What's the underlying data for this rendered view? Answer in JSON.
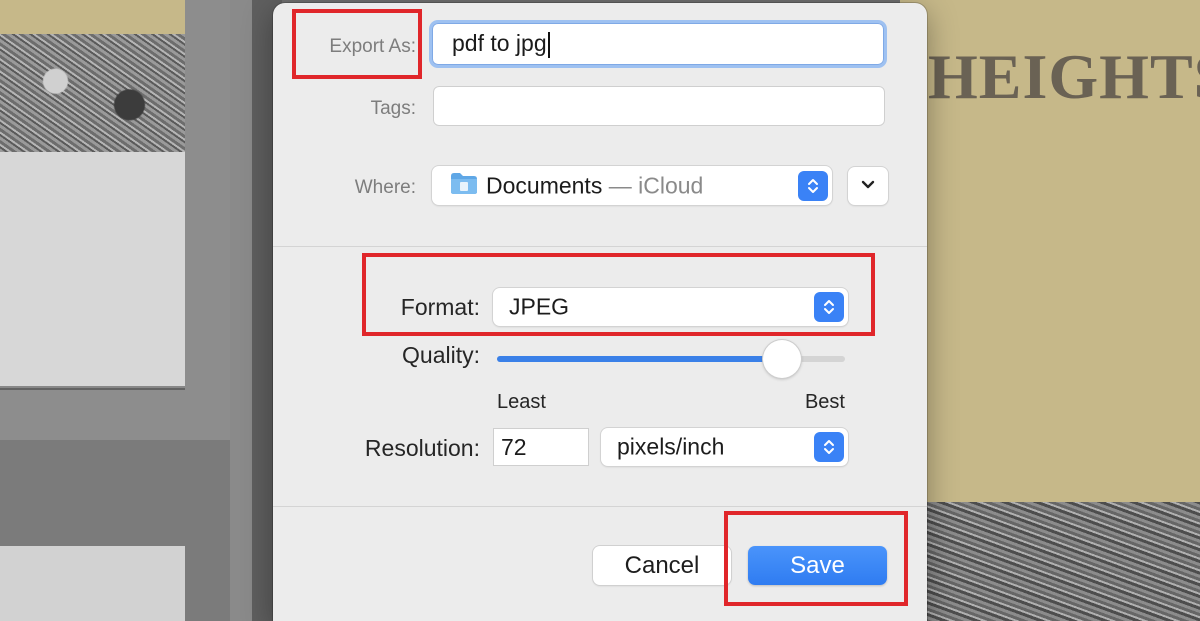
{
  "background": {
    "heading": "HEIGHTS"
  },
  "dialog": {
    "export_as": {
      "label": "Export As:",
      "value": "pdf to jpg"
    },
    "tags": {
      "label": "Tags:",
      "value": ""
    },
    "where": {
      "label": "Where:",
      "location": "Documents",
      "provider": " — iCloud",
      "icon": "folder-icon"
    },
    "format": {
      "label": "Format:",
      "value": "JPEG"
    },
    "quality": {
      "label": "Quality:",
      "min_label": "Least",
      "max_label": "Best",
      "level": 0.82
    },
    "resolution": {
      "label": "Resolution:",
      "value": "72",
      "unit": "pixels/inch"
    },
    "buttons": {
      "cancel": "Cancel",
      "save": "Save"
    }
  },
  "colors": {
    "accent": "#3a82f6",
    "highlight": "#e0262a",
    "dialog_bg": "#ececec",
    "background_cream": "#c6b889"
  }
}
